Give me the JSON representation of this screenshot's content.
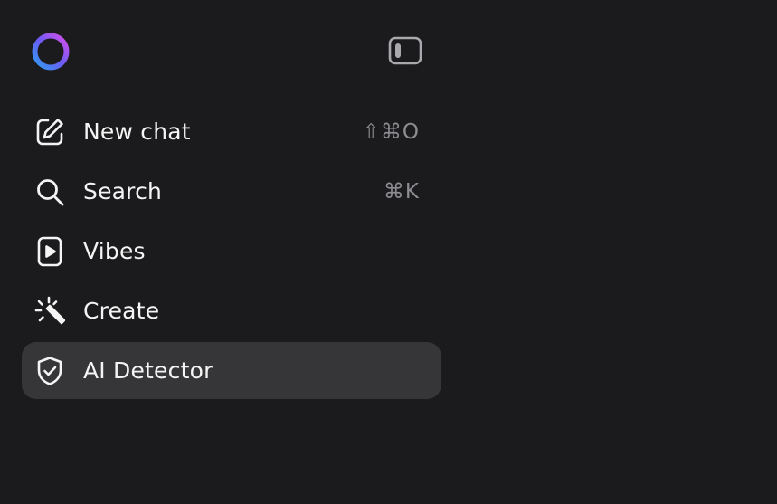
{
  "app": {
    "logo_icon": "ring-logo-icon",
    "collapse_icon": "sidebar-toggle-icon"
  },
  "nav": {
    "items": [
      {
        "label": "New chat",
        "icon": "edit-square-icon",
        "shortcut": "⇧⌘O",
        "active": false
      },
      {
        "label": "Search",
        "icon": "search-icon",
        "shortcut": "⌘K",
        "active": false
      },
      {
        "label": "Vibes",
        "icon": "play-video-icon",
        "shortcut": "",
        "active": false
      },
      {
        "label": "Create",
        "icon": "magic-wand-icon",
        "shortcut": "",
        "active": false
      },
      {
        "label": "AI Detector",
        "icon": "shield-check-icon",
        "shortcut": "",
        "active": true
      }
    ]
  },
  "colors": {
    "background": "#1b1a1c",
    "active_item": "#363538",
    "text": "#f4f4f4",
    "muted": "#8d8c90",
    "logo_gradient": [
      "#3b82f6",
      "#8b5cf6",
      "#d946ef"
    ]
  }
}
